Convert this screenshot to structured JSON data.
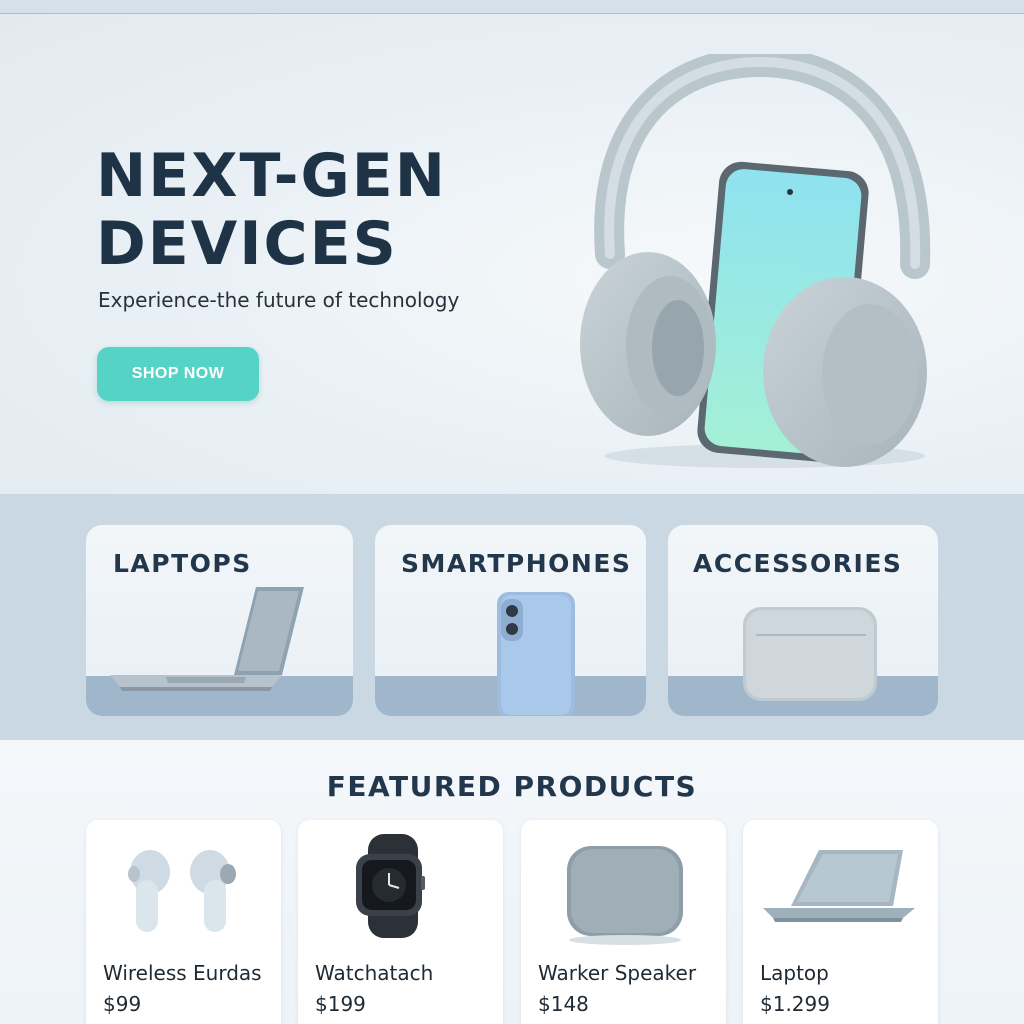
{
  "hero": {
    "title_line1": "NEXT-GEN",
    "title_line2": "DEVICES",
    "subtitle": "Experience-the future of technology",
    "cta": "SHOP NOW"
  },
  "categories": [
    {
      "label": "LAPTOPS",
      "icon": "laptop-icon"
    },
    {
      "label": "SMARTPHONES",
      "icon": "smartphone-icon"
    },
    {
      "label": "ACCESSORIES",
      "icon": "accessory-case-icon"
    }
  ],
  "featured": {
    "title": "FEATURED PRODUCTS",
    "products": [
      {
        "name": "Wireless Eurdas",
        "price": "$99",
        "icon": "earbuds-icon"
      },
      {
        "name": "Watchatach",
        "price": "$199",
        "icon": "smartwatch-icon"
      },
      {
        "name": "Warker Speaker",
        "price": "$148",
        "icon": "speaker-icon"
      },
      {
        "name": "Laptop",
        "price": "$1.299",
        "icon": "laptop-icon"
      }
    ]
  },
  "colors": {
    "accent": "#55d3c4",
    "heading": "#1f3347",
    "category_band": "#c9d8e3"
  }
}
